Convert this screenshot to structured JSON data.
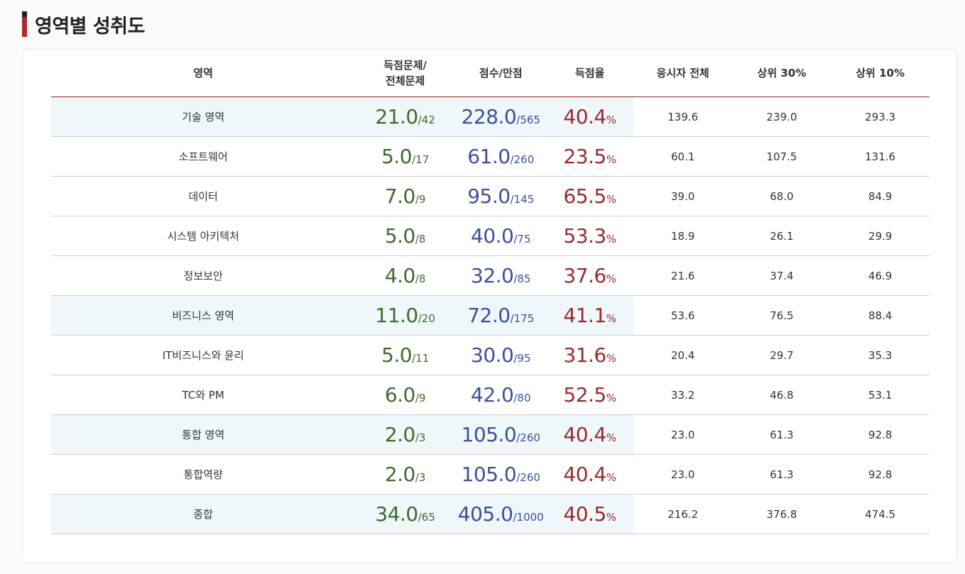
{
  "section": {
    "title": "영역별 성취도"
  },
  "colors": {
    "green": "#3d6b2c",
    "blue": "#3c4f9e",
    "red": "#9a2a2a",
    "highlight": "#eff7fa",
    "accent": "#b3262a"
  },
  "table": {
    "headers": {
      "area": "영역",
      "questions_line1": "득점문제/",
      "questions_line2": "전체문제",
      "score": "점수/만점",
      "rate": "득점율",
      "all": "응시자 전체",
      "top30": "상위 30%",
      "top10": "상위 10%"
    },
    "rows": [
      {
        "name": "기술 영역",
        "highlight": true,
        "q": "21.0",
        "q_total": "/42",
        "s": "228.0",
        "s_total": "/565",
        "rate": "40.4",
        "pct": "%",
        "all": "139.6",
        "top30": "239.0",
        "top10": "293.3"
      },
      {
        "name": "소프트웨어",
        "highlight": false,
        "q": "5.0",
        "q_total": "/17",
        "s": "61.0",
        "s_total": "/260",
        "rate": "23.5",
        "pct": "%",
        "all": "60.1",
        "top30": "107.5",
        "top10": "131.6"
      },
      {
        "name": "데이터",
        "highlight": false,
        "q": "7.0",
        "q_total": "/9",
        "s": "95.0",
        "s_total": "/145",
        "rate": "65.5",
        "pct": "%",
        "all": "39.0",
        "top30": "68.0",
        "top10": "84.9"
      },
      {
        "name": "시스템 아키텍처",
        "highlight": false,
        "q": "5.0",
        "q_total": "/8",
        "s": "40.0",
        "s_total": "/75",
        "rate": "53.3",
        "pct": "%",
        "all": "18.9",
        "top30": "26.1",
        "top10": "29.9"
      },
      {
        "name": "정보보안",
        "highlight": false,
        "q": "4.0",
        "q_total": "/8",
        "s": "32.0",
        "s_total": "/85",
        "rate": "37.6",
        "pct": "%",
        "all": "21.6",
        "top30": "37.4",
        "top10": "46.9"
      },
      {
        "name": "비즈니스 영역",
        "highlight": true,
        "q": "11.0",
        "q_total": "/20",
        "s": "72.0",
        "s_total": "/175",
        "rate": "41.1",
        "pct": "%",
        "all": "53.6",
        "top30": "76.5",
        "top10": "88.4"
      },
      {
        "name": "IT비즈니스와 윤리",
        "highlight": false,
        "q": "5.0",
        "q_total": "/11",
        "s": "30.0",
        "s_total": "/95",
        "rate": "31.6",
        "pct": "%",
        "all": "20.4",
        "top30": "29.7",
        "top10": "35.3"
      },
      {
        "name": "TC와 PM",
        "highlight": false,
        "q": "6.0",
        "q_total": "/9",
        "s": "42.0",
        "s_total": "/80",
        "rate": "52.5",
        "pct": "%",
        "all": "33.2",
        "top30": "46.8",
        "top10": "53.1"
      },
      {
        "name": "통합 영역",
        "highlight": true,
        "q": "2.0",
        "q_total": "/3",
        "s": "105.0",
        "s_total": "/260",
        "rate": "40.4",
        "pct": "%",
        "all": "23.0",
        "top30": "61.3",
        "top10": "92.8"
      },
      {
        "name": "통합역량",
        "highlight": false,
        "q": "2.0",
        "q_total": "/3",
        "s": "105.0",
        "s_total": "/260",
        "rate": "40.4",
        "pct": "%",
        "all": "23.0",
        "top30": "61.3",
        "top10": "92.8"
      },
      {
        "name": "종합",
        "highlight": true,
        "q": "34.0",
        "q_total": "/65",
        "s": "405.0",
        "s_total": "/1000",
        "rate": "40.5",
        "pct": "%",
        "all": "216.2",
        "top30": "376.8",
        "top10": "474.5"
      }
    ]
  }
}
